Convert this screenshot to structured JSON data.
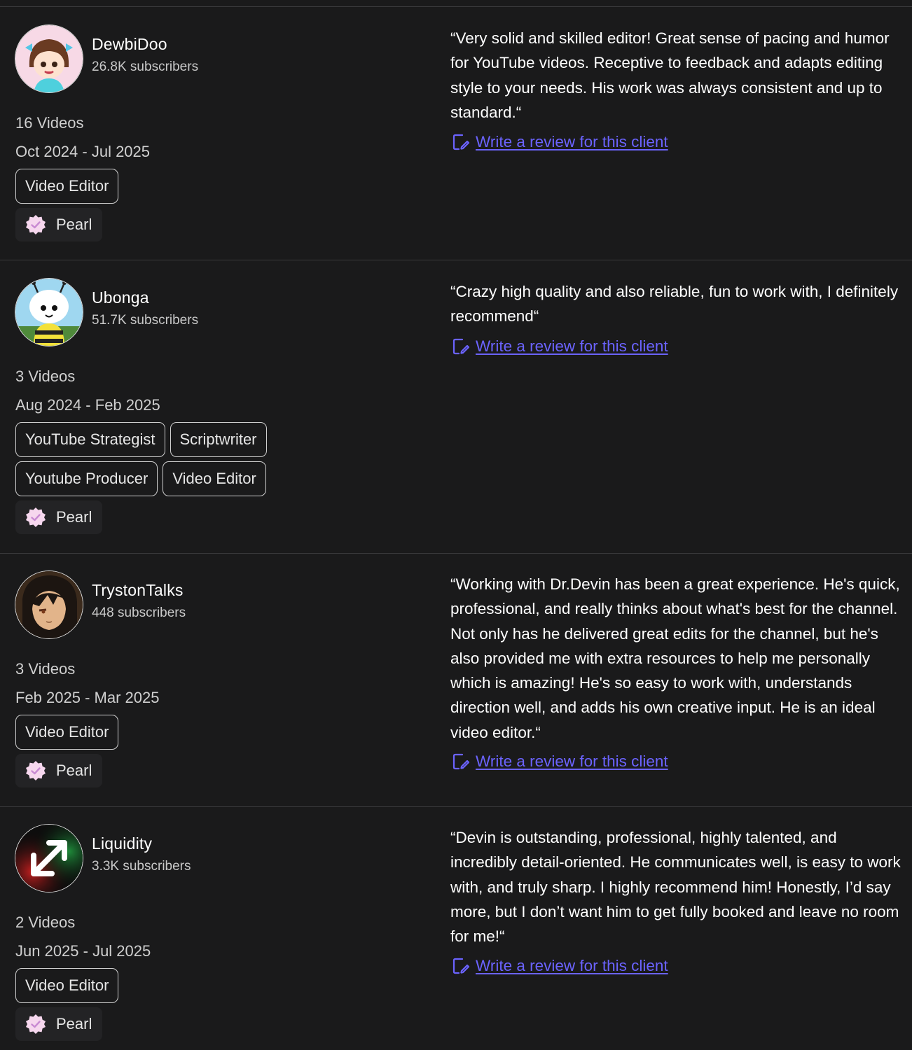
{
  "colors": {
    "background": "#1a1a1b",
    "link": "#6b63ff",
    "badge_bg": "#232325"
  },
  "clients": [
    {
      "name": "DewbiDoo",
      "subscribers": "26.8K subscribers",
      "videos": "16 Videos",
      "dates": "Oct 2024 - Jul 2025",
      "roles": [
        "Video Editor"
      ],
      "badge": "Pearl",
      "avatar_icon": "anime-girl-avatar",
      "quote": "“Very solid and skilled editor! Great sense of pacing and humor for YouTube videos. Receptive to feedback and adapts editing style to your needs. His work was always consistent and up to standard.“",
      "review_link": "Write a review for this client"
    },
    {
      "name": "Ubonga",
      "subscribers": "51.7K subscribers",
      "videos": "3 Videos",
      "dates": "Aug 2024 - Feb 2025",
      "roles": [
        "YouTube Strategist",
        "Scriptwriter",
        "Youtube Producer",
        "Video Editor"
      ],
      "badge": "Pearl",
      "avatar_icon": "bee-mascot-avatar",
      "quote": "“Crazy high quality and also reliable, fun to work with, I definitely recommend“",
      "review_link": "Write a review for this client"
    },
    {
      "name": "TrystonTalks",
      "subscribers": "448 subscribers",
      "videos": "3 Videos",
      "dates": "Feb 2025 - Mar 2025",
      "roles": [
        "Video Editor"
      ],
      "badge": "Pearl",
      "avatar_icon": "anime-character-avatar",
      "quote": "“Working with Dr.Devin has been a great experience. He's quick, professional, and really thinks about what's best for the channel. Not only has he delivered great edits for the channel, but he's also provided me with extra resources to help me personally which is amazing! He's so easy to work with, understands direction well, and adds his own creative input. He is an ideal video editor.“",
      "review_link": "Write a review for this client"
    },
    {
      "name": "Liquidity",
      "subscribers": "3.3K subscribers",
      "videos": "2 Videos",
      "dates": "Jun 2025 - Jul 2025",
      "roles": [
        "Video Editor"
      ],
      "badge": "Pearl",
      "avatar_icon": "arrow-logo-avatar",
      "quote": "“Devin is outstanding, professional, highly talented, and incredibly detail-oriented. He communicates well, is easy to work with, and truly sharp. I highly recommend him! Honestly, I’d say more, but I don’t want him to get fully booked and leave no room for me!“",
      "review_link": "Write a review for this client"
    }
  ]
}
